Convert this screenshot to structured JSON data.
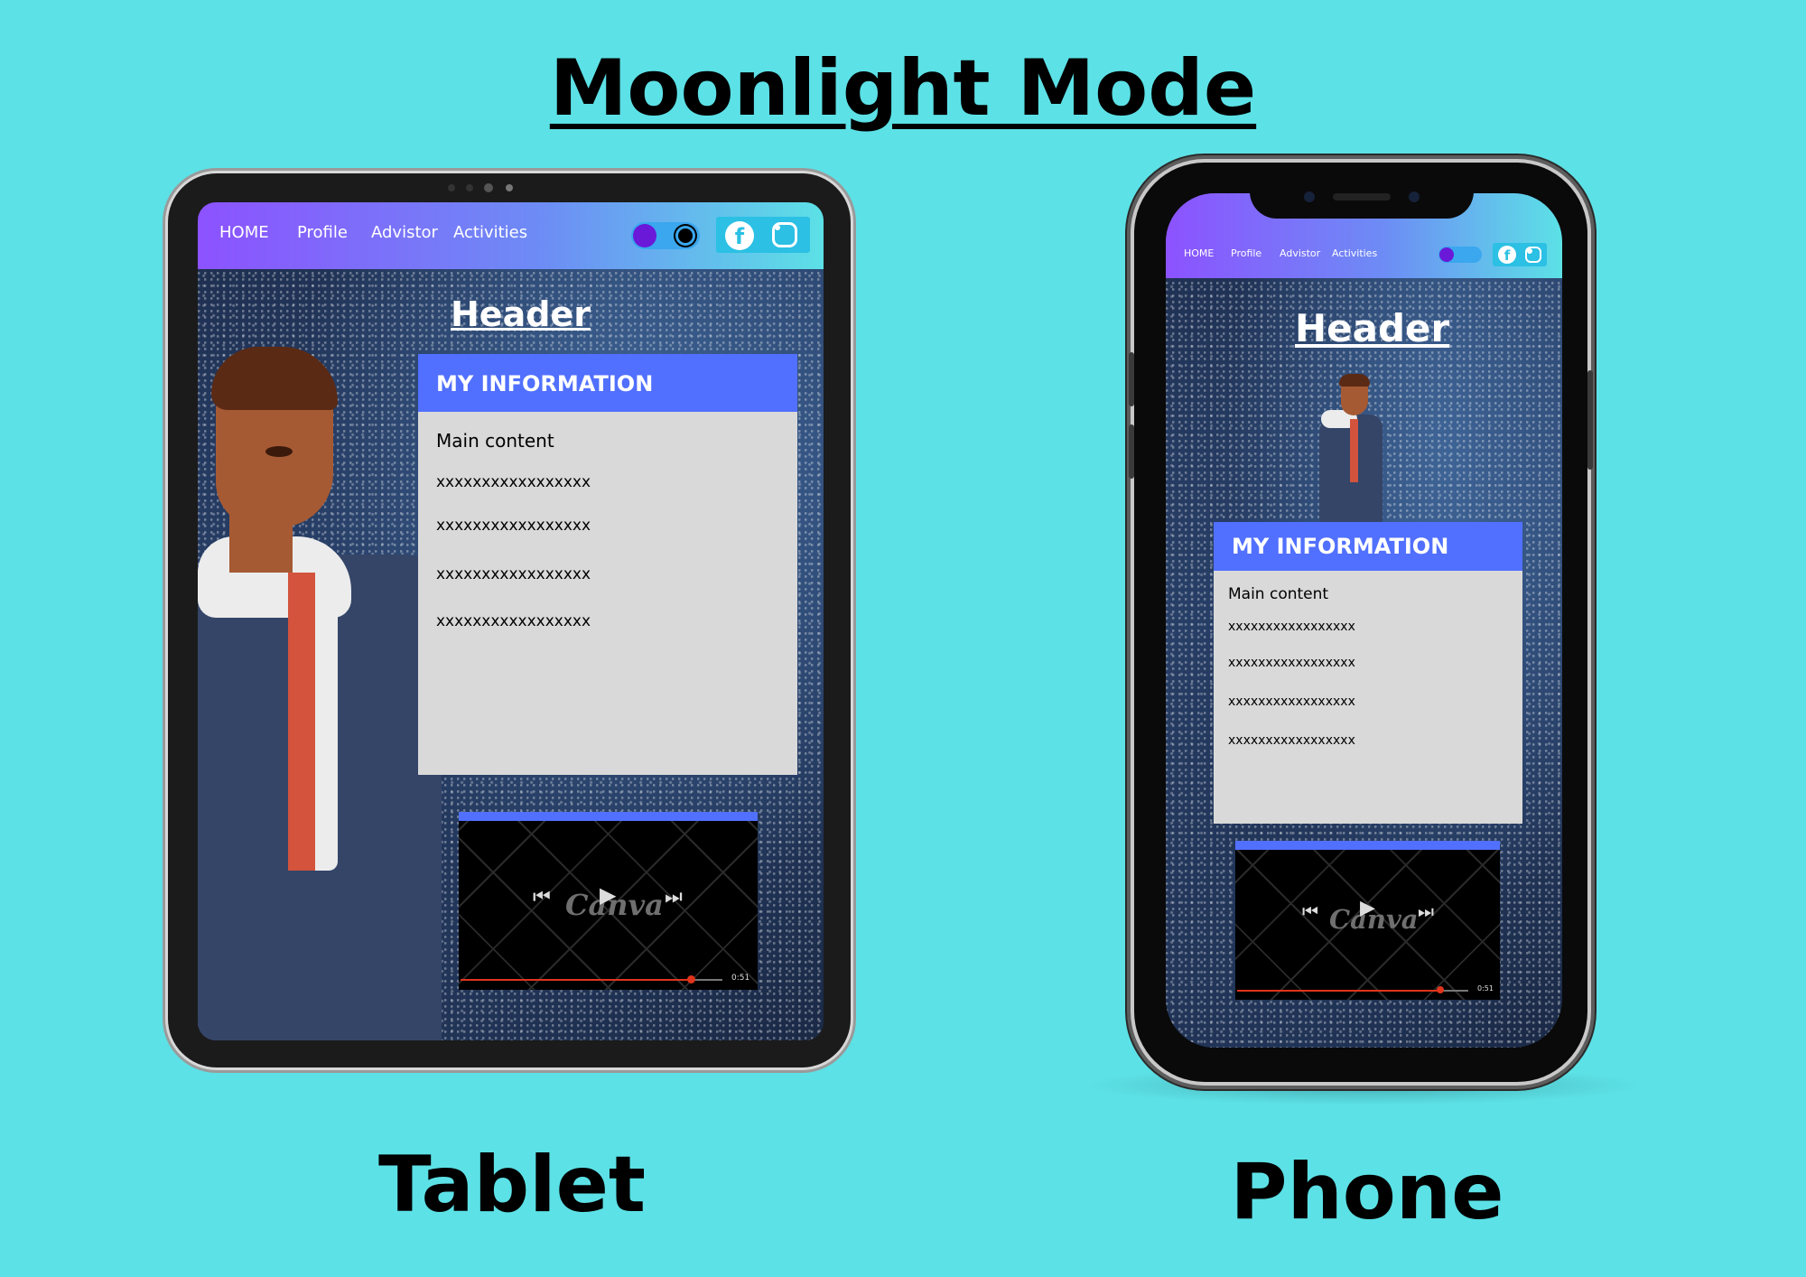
{
  "title": "Moonlight Mode",
  "devices": {
    "tablet_label": "Tablet",
    "phone_label": "Phone"
  },
  "nav": {
    "items": [
      "HOME",
      "Profile",
      "Advistor",
      "Activities"
    ]
  },
  "screen": {
    "header": "Header",
    "card_title": "MY INFORMATION",
    "lines": [
      "Main content",
      "xxxxxxxxxxxxxxxxx",
      "xxxxxxxxxxxxxxxxx",
      "xxxxxxxxxxxxxxxxx",
      "xxxxxxxxxxxxxxxxx"
    ]
  },
  "video": {
    "logo": "Canva",
    "time": "0:51",
    "progress": 0.88
  },
  "colors": {
    "background": "#5ce1e6",
    "card_header": "#5170ff",
    "card_body": "#d9d9d9",
    "nav_start": "#8c52ff",
    "nav_end": "#5ce1e6"
  },
  "icons": [
    "moon-icon",
    "sun-icon",
    "facebook-icon",
    "instagram-icon",
    "previous-icon",
    "play-icon",
    "next-icon"
  ]
}
